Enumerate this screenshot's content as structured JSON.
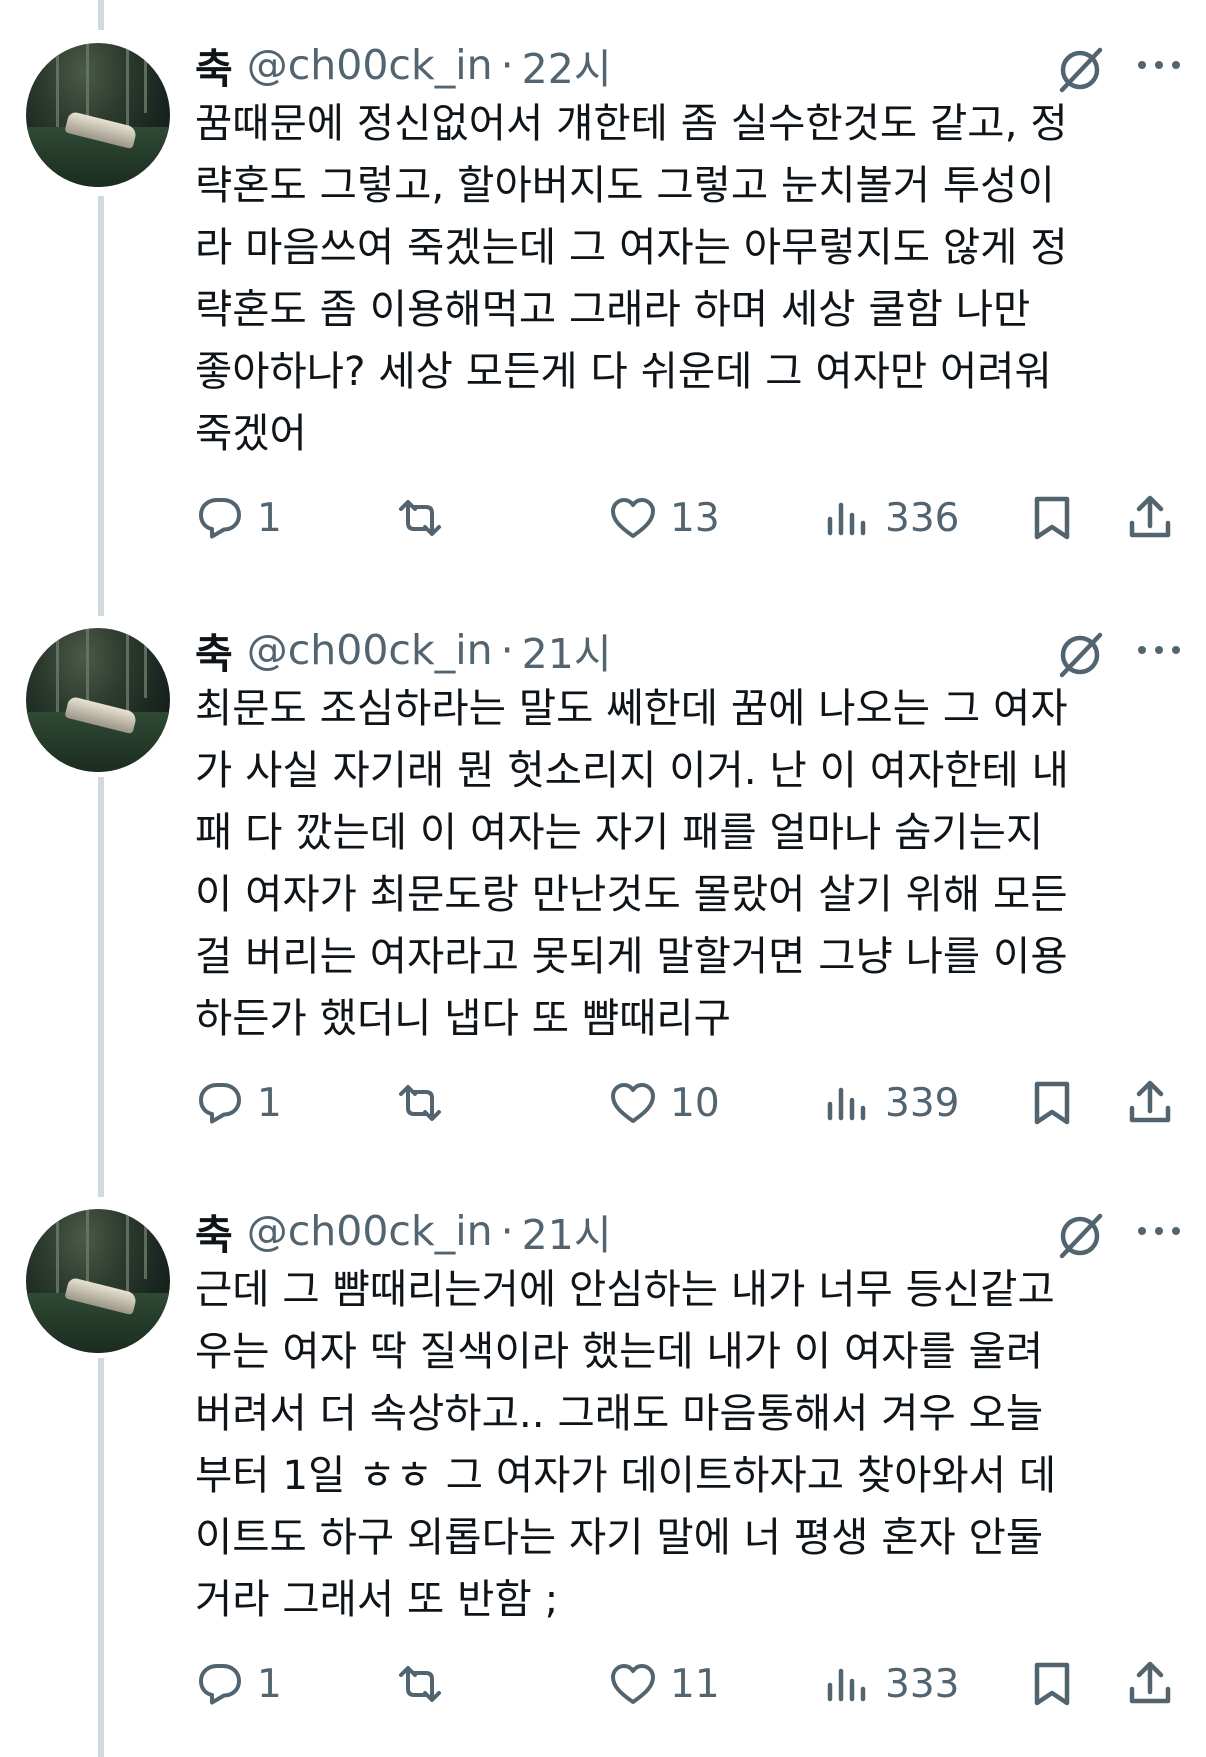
{
  "tweets": [
    {
      "name": "축",
      "handle": "@ch00ck_in",
      "separator": "·",
      "time": "22시",
      "text": "꿈때문에 정신없어서 걔한테 좀 실수한것도 같고, 정\n략혼도 그렇고, 할아버지도 그렇고 눈치볼거 투성이\n라 마음쓰여 죽겠는데 그 여자는 아무렇지도 않게 정\n략혼도 좀 이용해먹고 그래라 하며 세상 쿨함 나만\n좋아하나? 세상 모든게 다 쉬운데 그 여자만 어려워\n죽겠어",
      "replies": "1",
      "retweets": "",
      "likes": "13",
      "views": "336"
    },
    {
      "name": "축",
      "handle": "@ch00ck_in",
      "separator": "·",
      "time": "21시",
      "text": "최문도 조심하라는 말도 쎄한데 꿈에 나오는 그 여자\n가 사실 자기래 뭔 헛소리지 이거. 난 이 여자한테 내\n패 다 깠는데 이 여자는 자기 패를 얼마나 숨기는지\n이 여자가 최문도랑 만난것도 몰랐어 살기 위해 모든\n걸 버리는 여자라고 못되게 말할거면 그냥 나를 이용\n하든가 했더니 냅다 또 뺨때리구",
      "replies": "1",
      "retweets": "",
      "likes": "10",
      "views": "339"
    },
    {
      "name": "축",
      "handle": "@ch00ck_in",
      "separator": "·",
      "time": "21시",
      "text": "근데 그 뺨때리는거에 안심하는 내가 너무 등신같고\n우는 여자 딱 질색이라 했는데 내가 이 여자를 울려\n버려서 더 속상하고.. 그래도 마음통해서 겨우 오늘\n부터 1일 ㅎㅎ 그 여자가 데이트하자고 찾아와서 데\n이트도 하구 외롭다는 자기 말에 너 평생 혼자 안둘\n거라 그래서 또 반함 ;",
      "replies": "1",
      "retweets": "",
      "likes": "11",
      "views": "333"
    }
  ],
  "colors": {
    "text": "#0f1419",
    "secondary": "#536471",
    "thread_line": "#cfd9de",
    "background": "#ffffff"
  },
  "icons": [
    "reply-icon",
    "retweet-icon",
    "like-icon",
    "views-icon",
    "bookmark-icon",
    "share-icon",
    "grok-icon",
    "more-icon"
  ]
}
